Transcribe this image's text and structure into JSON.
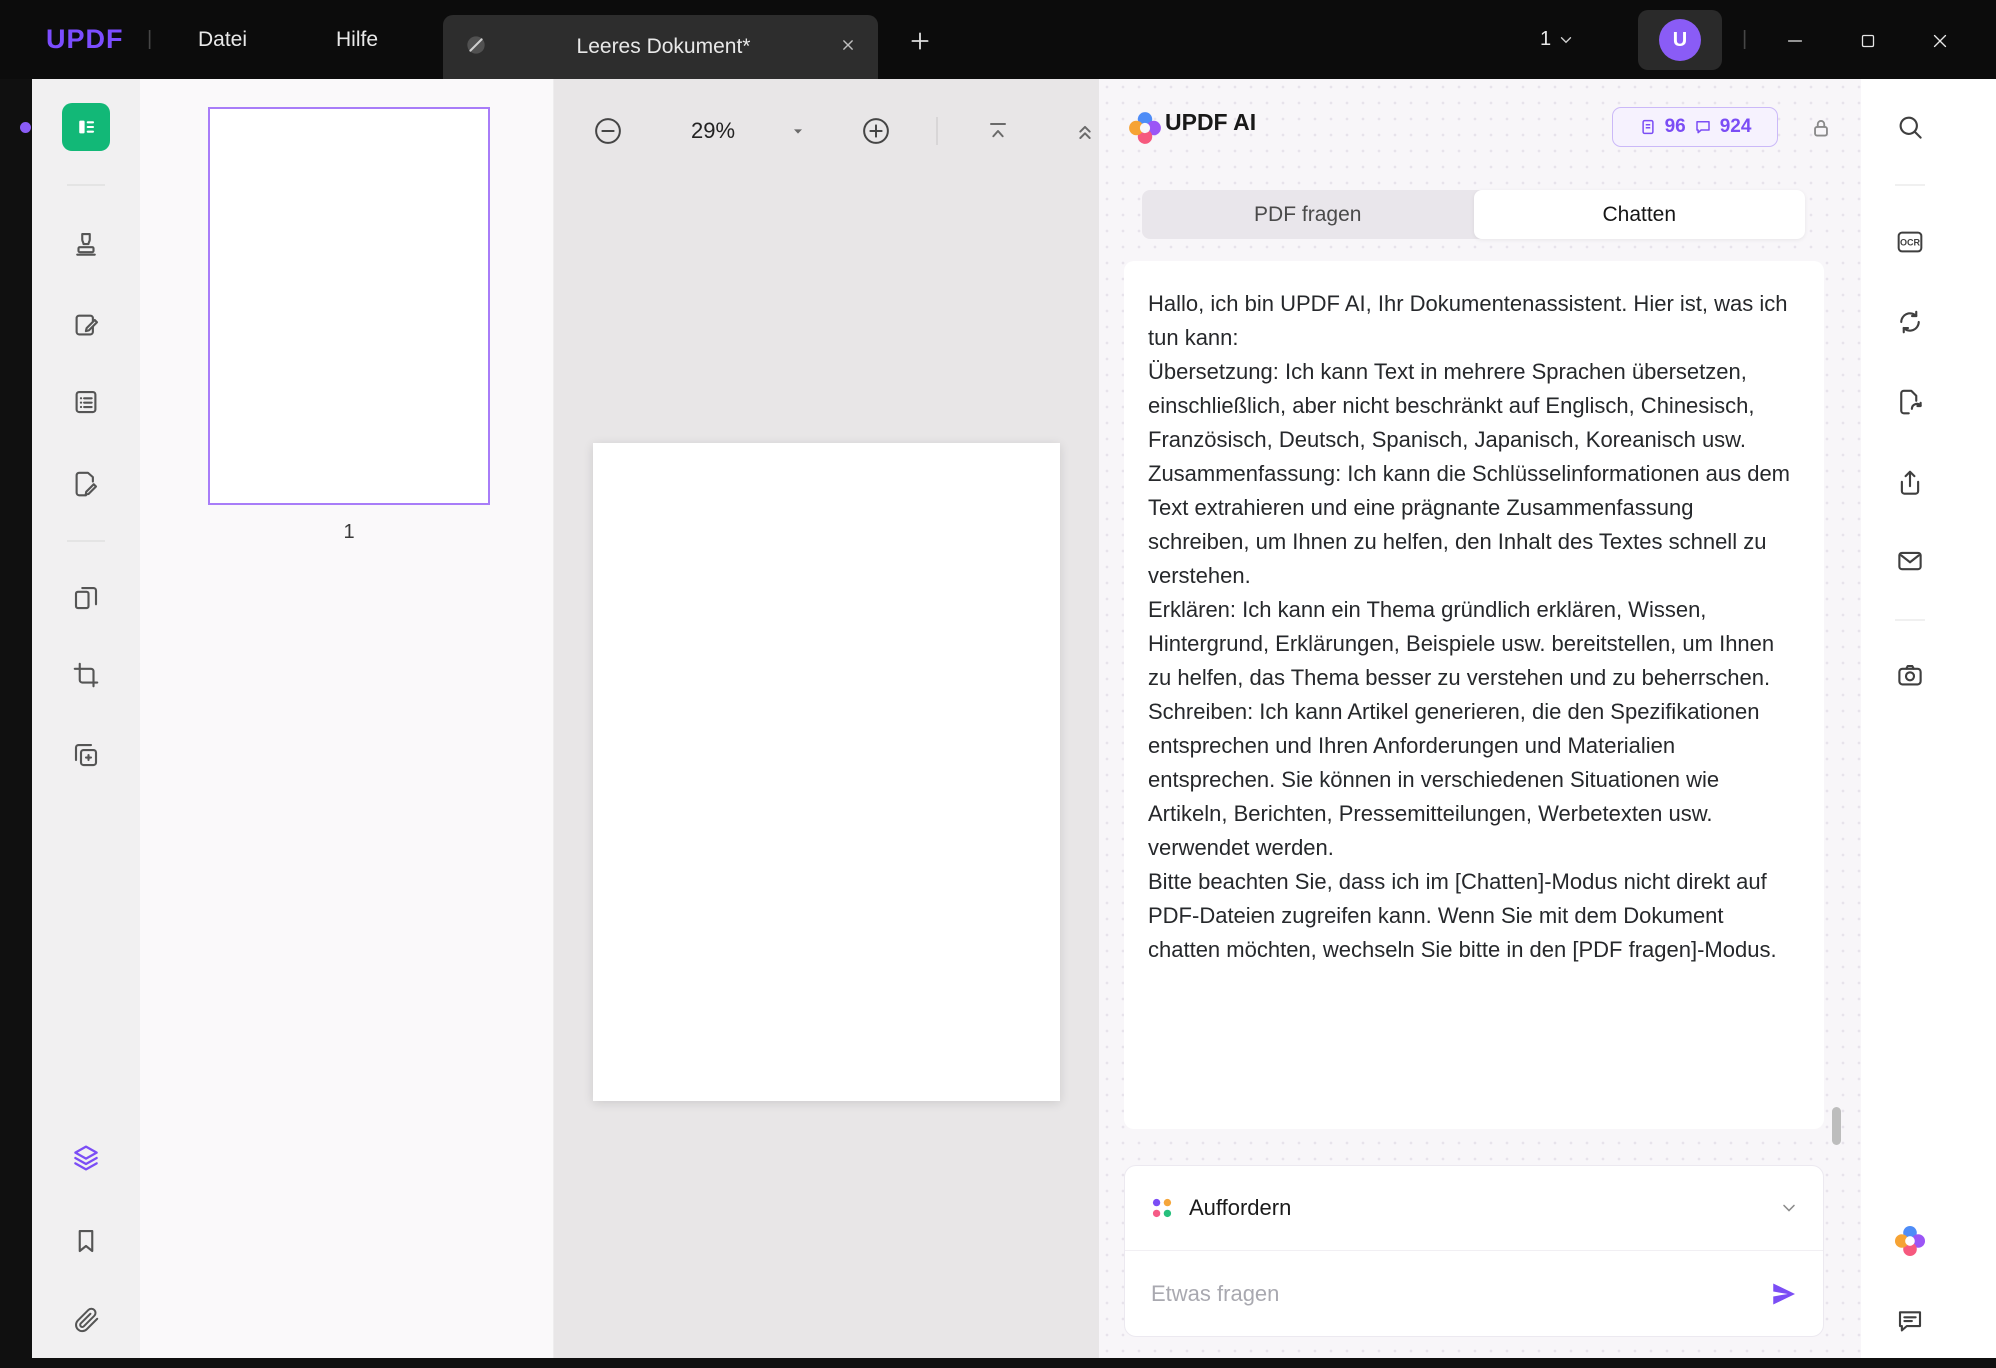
{
  "window": {
    "logo": "UPDF",
    "menu": [
      {
        "label": "Datei"
      },
      {
        "label": "Hilfe"
      }
    ],
    "tab_title": "Leeres Dokument*",
    "notification_count": "1",
    "avatar_initial": "U"
  },
  "thumbnails": {
    "page_label": "1"
  },
  "canvas": {
    "zoom_level": "29%"
  },
  "ai": {
    "title": "UPDF AI",
    "quota_pages": "96",
    "quota_chats": "924",
    "tab_ask": "PDF fragen",
    "tab_chat": "Chatten",
    "message": [
      "Hallo, ich bin UPDF AI, Ihr Dokumentenassistent. Hier ist, was ich tun kann:",
      "Übersetzung: Ich kann Text in mehrere Sprachen übersetzen, einschließlich, aber nicht beschränkt auf Englisch, Chinesisch, Französisch, Deutsch, Spanisch, Japanisch, Koreanisch usw.",
      "Zusammenfassung: Ich kann die Schlüsselinformationen aus dem Text extrahieren und eine prägnante Zusammenfassung schreiben, um Ihnen zu helfen, den Inhalt des Textes schnell zu verstehen.",
      "Erklären: Ich kann ein Thema gründlich erklären, Wissen, Hintergrund, Erklärungen, Beispiele usw. bereitstellen, um Ihnen zu helfen, das Thema besser zu verstehen und zu beherrschen.",
      "Schreiben: Ich kann Artikel generieren, die den Spezifikationen entsprechen und Ihren Anforderungen und Materialien entsprechen. Sie können in verschiedenen Situationen wie Artikeln, Berichten, Pressemitteilungen, Werbetexten usw. verwendet werden.",
      "Bitte beachten Sie, dass ich im [Chatten]-Modus nicht direkt auf PDF-Dateien zugreifen kann. Wenn Sie mit dem Dokument chatten möchten, wechseln Sie bitte in den [PDF fragen]-Modus."
    ],
    "prompt_label": "Auffordern",
    "input_placeholder": "Etwas fragen"
  },
  "right_toolbar": {
    "ocr_label": "OCR"
  },
  "colors": {
    "accent": "#7B4DF5",
    "reader_green": "#12B877",
    "titlebar": "#0C0C0C"
  }
}
